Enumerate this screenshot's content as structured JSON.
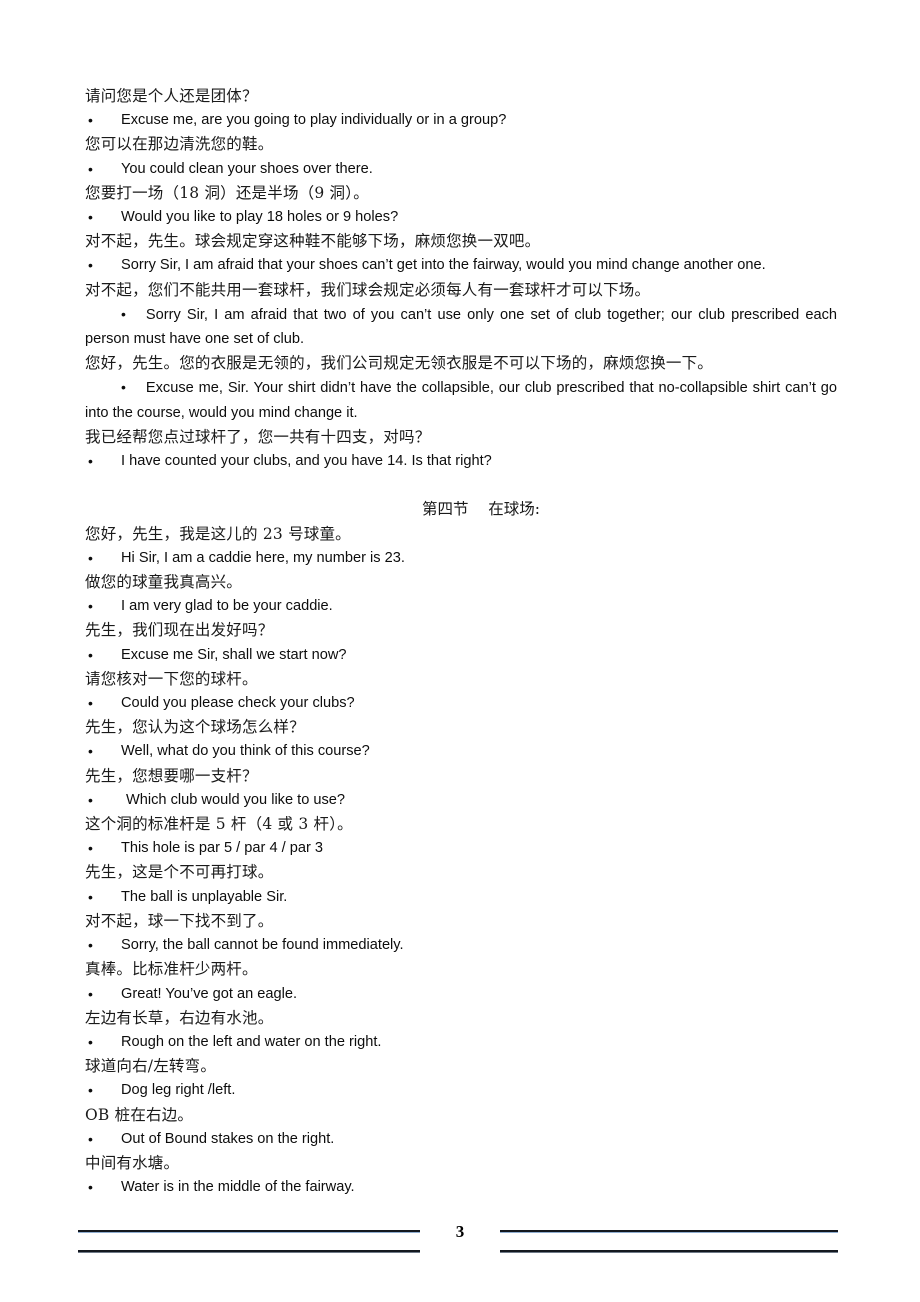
{
  "document": {
    "page_number": "3",
    "bullet_glyph": "•"
  },
  "blocks": [
    {
      "type": "zh",
      "text": "请问您是个人还是团体？"
    },
    {
      "type": "en",
      "text": "Excuse me, are you going to play individually or in a group?"
    },
    {
      "type": "zh",
      "text": "您可以在那边清洗您的鞋。"
    },
    {
      "type": "en",
      "text": "You could clean your shoes over there."
    },
    {
      "type": "zh",
      "text": "您要打一场（18 洞）还是半场（9 洞）。"
    },
    {
      "type": "en",
      "text": "Would you like to play 18 holes or 9 holes?"
    },
    {
      "type": "zh",
      "text": "对不起，先生。球会规定穿这种鞋不能够下场，麻烦您换一双吧。"
    },
    {
      "type": "en",
      "text": "Sorry Sir, I am afraid that your shoes can’t get into the fairway, would you mind change another one."
    },
    {
      "type": "zh",
      "text": "对不起，您们不能共用一套球杆，我们球会规定必须每人有一套球杆才可以下场。"
    },
    {
      "type": "en-justified",
      "text": "Sorry Sir, I am afraid that two of you can’t use only one set of club together; our club prescribed each person must have one set of club."
    },
    {
      "type": "zh",
      "text": "您好，先生。您的衣服是无领的，我们公司规定无领衣服是不可以下场的，麻烦您换一下。"
    },
    {
      "type": "en-justified",
      "text": "Excuse me, Sir. Your shirt didn’t have the collapsible, our club prescribed that no-collapsible shirt can’t go into the course, would you mind change it."
    },
    {
      "type": "zh",
      "text": "我已经帮您点过球杆了，您一共有十四支，对吗？"
    },
    {
      "type": "en",
      "text": "I have counted your clubs, and you have 14. Is that right?"
    },
    {
      "type": "gap",
      "text": ""
    },
    {
      "type": "heading",
      "text": "第四节    在球场:"
    },
    {
      "type": "zh",
      "text": "您好，先生，我是这儿的 23 号球童。"
    },
    {
      "type": "en",
      "text": "Hi Sir, I am a caddie here, my number is 23."
    },
    {
      "type": "zh",
      "text": "做您的球童我真高兴。"
    },
    {
      "type": "en",
      "text": "I am very glad to be your caddie."
    },
    {
      "type": "zh",
      "text": "先生，我们现在出发好吗？"
    },
    {
      "type": "en",
      "text": "Excuse me Sir, shall we start now?"
    },
    {
      "type": "zh",
      "text": "请您核对一下您的球杆。"
    },
    {
      "type": "en",
      "text": "Could you please check your clubs?"
    },
    {
      "type": "zh",
      "text": "先生，您认为这个球场怎么样？"
    },
    {
      "type": "en",
      "text": "Well, what do you think of this course?"
    },
    {
      "type": "zh",
      "text": "先生，您想要哪一支杆？"
    },
    {
      "type": "en-indent",
      "text": "Which club would you like to use?"
    },
    {
      "type": "zh",
      "text": "这个洞的标准杆是 5 杆（4 或 3 杆）。"
    },
    {
      "type": "en",
      "text": "This hole is par 5 / par 4 / par 3"
    },
    {
      "type": "zh",
      "text": "先生，这是个不可再打球。"
    },
    {
      "type": "en",
      "text": "The ball is unplayable Sir."
    },
    {
      "type": "zh",
      "text": "对不起，球一下找不到了。"
    },
    {
      "type": "en",
      "text": "Sorry, the ball cannot be found immediately."
    },
    {
      "type": "zh",
      "text": "真棒。比标准杆少两杆。"
    },
    {
      "type": "en",
      "text": "Great! You’ve got an eagle."
    },
    {
      "type": "zh",
      "text": "左边有长草，右边有水池。"
    },
    {
      "type": "en",
      "text": "Rough on the left and water on the right."
    },
    {
      "type": "zh",
      "text": "球道向右/左转弯。"
    },
    {
      "type": "en",
      "text": "Dog leg right /left."
    },
    {
      "type": "zh",
      "text": "OB 桩在右边。"
    },
    {
      "type": "en",
      "text": "Out of Bound stakes on the right."
    },
    {
      "type": "zh",
      "text": "中间有水塘。"
    },
    {
      "type": "en",
      "text": "Water is in the middle of the fairway."
    }
  ]
}
